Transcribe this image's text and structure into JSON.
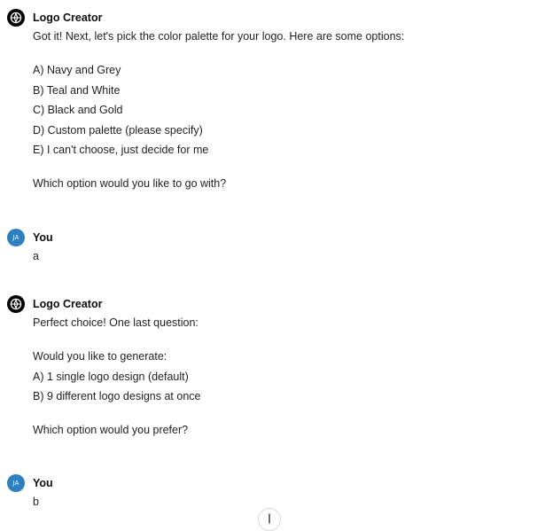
{
  "messages": [
    {
      "author": "Logo Creator",
      "role": "bot",
      "icon": "gpt-logo-icon",
      "lines": [
        "Got it! Next, let's pick the color palette for your logo. Here are some options:",
        "",
        "A) Navy and Grey",
        "B) Teal and White",
        "C) Black and Gold",
        "D) Custom palette (please specify)",
        "E) I can't choose, just decide for me",
        "",
        "Which option would you like to go with?"
      ]
    },
    {
      "author": "You",
      "role": "user",
      "avatar_initials": "JA",
      "lines": [
        "a"
      ]
    },
    {
      "author": "Logo Creator",
      "role": "bot",
      "icon": "gpt-logo-icon",
      "lines": [
        "Perfect choice! One last question:",
        "",
        "Would you like to generate:",
        "A) 1 single logo design (default)",
        "B) 9 different logo designs at once",
        "",
        "Which option would you prefer?"
      ]
    },
    {
      "author": "You",
      "role": "user",
      "avatar_initials": "JA",
      "lines": [
        "b"
      ]
    }
  ],
  "scroll_button": {
    "icon": "arrow-down-icon"
  },
  "colors": {
    "user_avatar": "#2e7fbf",
    "bot_avatar": "#000000"
  }
}
